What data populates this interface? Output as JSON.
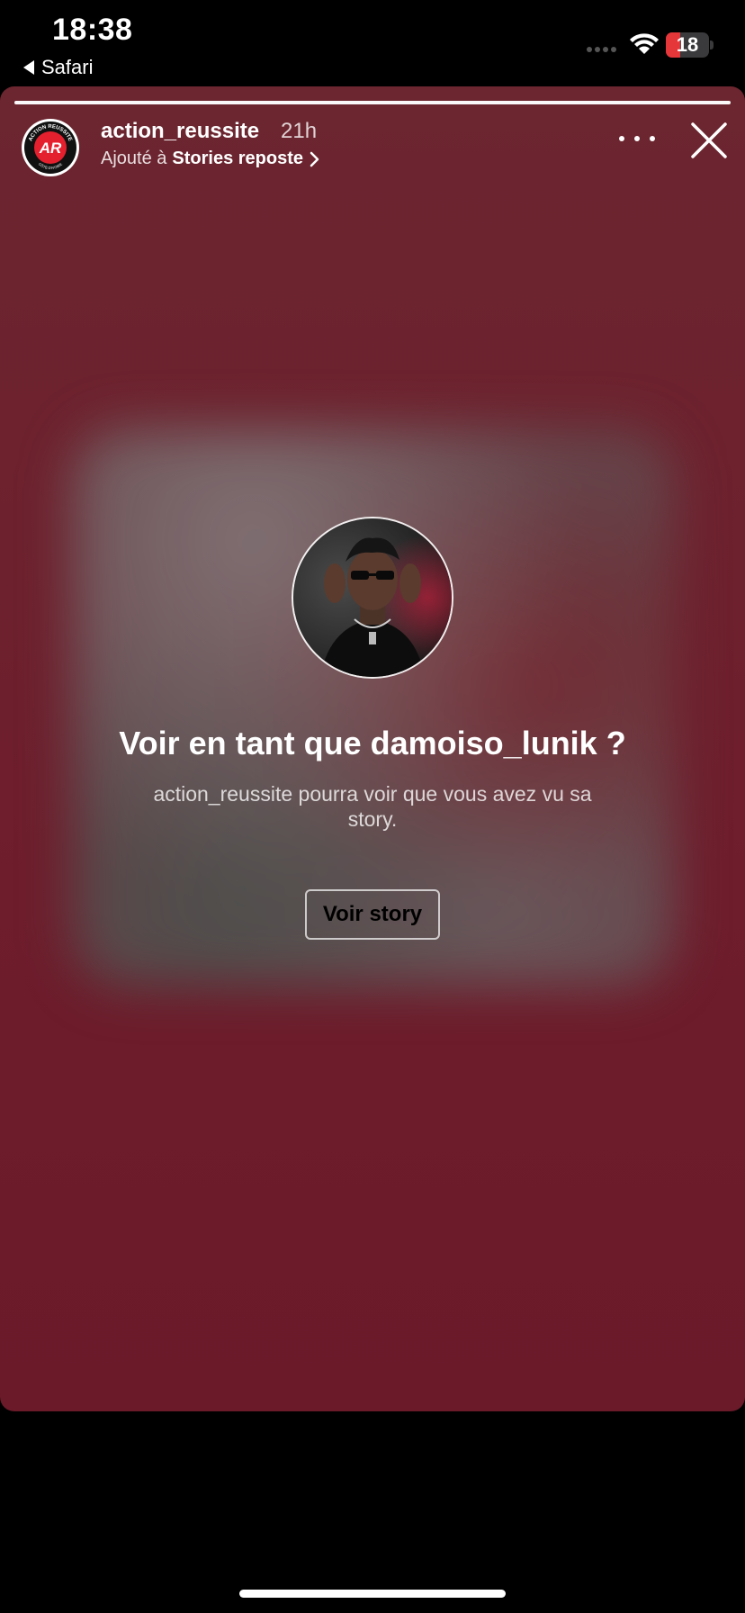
{
  "status_bar": {
    "time": "18:38",
    "back_app": "Safari",
    "battery_level": "18",
    "battery_color": "#e5363a",
    "icons": [
      "cellular-signal-icon",
      "wifi-icon",
      "battery-icon"
    ]
  },
  "story": {
    "progress": 1.0,
    "username": "action_reussite",
    "time_ago": "21h",
    "added_prefix": "Ajouté à",
    "added_collection": "Stories reposte",
    "background_color": "#6c2630",
    "accent_brand_color": "#e5202e"
  },
  "prompt": {
    "title": "Voir en tant que damoiso_lunik ?",
    "subtitle": "action_reussite pourra voir que vous avez vu sa story.",
    "button_label": "Voir story"
  },
  "logo": {
    "letters": "AR",
    "ring_text": "ACTION REUSSITE",
    "ring_text_bottom": "CÔTE D'IVOIRE"
  }
}
